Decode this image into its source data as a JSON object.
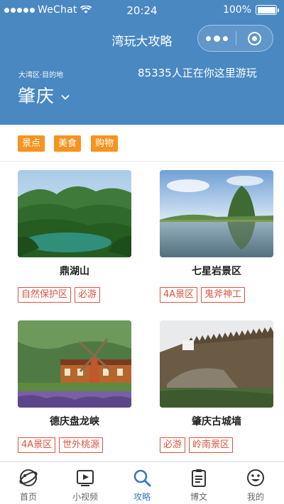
{
  "status_bar": {
    "carrier": "WeChat",
    "time": "20:24",
    "battery": "100%",
    "battery_level": 1.0
  },
  "nav": {
    "title": "湾玩大攻略"
  },
  "location": {
    "region_label": "大湾区·目的地",
    "city": "肇庆",
    "visitor_text": "85335人正在你这里游玩"
  },
  "category_tabs": [
    {
      "label": "景点"
    },
    {
      "label": "美食"
    },
    {
      "label": "购物"
    }
  ],
  "spots": [
    {
      "name": "鼎湖山",
      "tags": [
        "自然保护区",
        "必游"
      ]
    },
    {
      "name": "七星岩景区",
      "tags": [
        "4A景区",
        "鬼斧神工"
      ]
    },
    {
      "name": "德庆盘龙峡",
      "tags": [
        "4A景区",
        "世外桃源"
      ]
    },
    {
      "name": "肇庆古城墙",
      "tags": [
        "必游",
        "岭南景区"
      ]
    }
  ],
  "tabbar": {
    "items": [
      {
        "label": "首页",
        "icon": "planet-icon"
      },
      {
        "label": "小视频",
        "icon": "video-play-icon"
      },
      {
        "label": "攻略",
        "icon": "search-icon"
      },
      {
        "label": "博文",
        "icon": "clipboard-icon"
      },
      {
        "label": "我的",
        "icon": "smiley-icon"
      }
    ],
    "active_label": "攻略"
  },
  "colors": {
    "header_blue": "#4a88c2",
    "tab_orange": "#f7931e",
    "tag_red": "#d9543f",
    "active_blue": "#3b78c0"
  }
}
